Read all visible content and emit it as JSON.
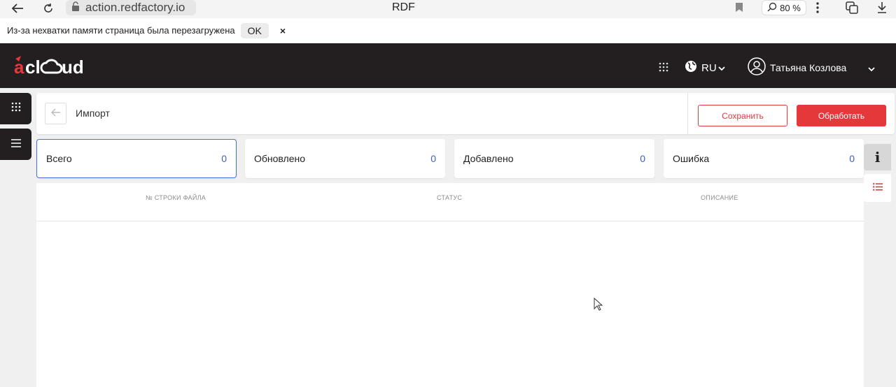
{
  "browser": {
    "url": "action.redfactory.io",
    "title": "RDF",
    "zoom": "80 %"
  },
  "notice": {
    "message": "Из-за нехватки памяти страница была перезагружена",
    "ok_label": "OK",
    "close_label": "×"
  },
  "header": {
    "logo_text": "acloud",
    "language": "RU",
    "user_name": "Татьяна Козлова"
  },
  "toolbar": {
    "title": "Импорт",
    "save_label": "Сохранить",
    "process_label": "Обработать"
  },
  "stats": [
    {
      "label": "Всего",
      "value": "0"
    },
    {
      "label": "Обновлено",
      "value": "0"
    },
    {
      "label": "Добавлено",
      "value": "0"
    },
    {
      "label": "Ошибка",
      "value": "0"
    }
  ],
  "table": {
    "columns": [
      "№ СТРОКИ ФАЙЛА",
      "СТАТУС",
      "ОПИСАНИЕ"
    ],
    "rows": []
  },
  "rail": {
    "info_label": "i"
  },
  "colors": {
    "brand_red": "#e5383b",
    "header_dark": "#231f20",
    "accent_blue": "#3a5fc8"
  }
}
